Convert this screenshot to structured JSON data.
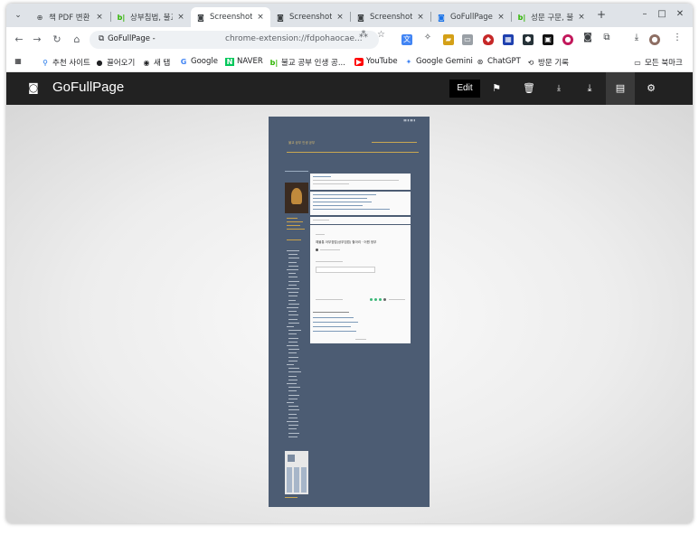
{
  "tabs": [
    {
      "label": "책 PDF 변환",
      "favicon": "globe",
      "active": false
    },
    {
      "label": "상부침법, 불교",
      "favicon": "bl",
      "active": false
    },
    {
      "label": "Screenshot",
      "favicon": "camera",
      "active": true
    },
    {
      "label": "Screenshot",
      "favicon": "camera",
      "active": false
    },
    {
      "label": "Screenshot",
      "favicon": "camera",
      "active": false
    },
    {
      "label": "GoFullPage",
      "favicon": "camera-blue",
      "active": false
    },
    {
      "label": "성문 구문, 불교",
      "favicon": "bl",
      "active": false
    }
  ],
  "tab_close": "×",
  "new_tab": "+",
  "window_controls": {
    "minimize": "–",
    "maximize": "□",
    "close": "✕"
  },
  "address": {
    "site_label": "GoFullPage -",
    "url": "chrome-extension://fdpohaocae..."
  },
  "bookmarks": [
    {
      "label": "추천 사이트",
      "icon": "search"
    },
    {
      "label": "끌어오기",
      "icon": "circle"
    },
    {
      "label": "새 탭",
      "icon": "github"
    },
    {
      "label": "Google",
      "icon": "google"
    },
    {
      "label": "NAVER",
      "icon": "naver"
    },
    {
      "label": "불교 공부 인생 공...",
      "icon": "bl"
    },
    {
      "label": "YouTube",
      "icon": "youtube"
    },
    {
      "label": "Google Gemini",
      "icon": "gemini"
    },
    {
      "label": "ChatGPT",
      "icon": "chatgpt"
    },
    {
      "label": "방문 기록",
      "icon": "history"
    }
  ],
  "all_bookmarks": "모든 북마크",
  "app": {
    "title": "GoFullPage",
    "edit_label": "Edit"
  },
  "preview": {
    "blog_title": "불교 공부 인생 공부",
    "post_title": "예불통 아부침법(상부침법) 할아리 · 어원 정부"
  },
  "colors": {
    "app_bar": "#222222",
    "page_bg": "#4c5c73",
    "gold": "#c9a852",
    "accent_green": "#3cb878"
  }
}
